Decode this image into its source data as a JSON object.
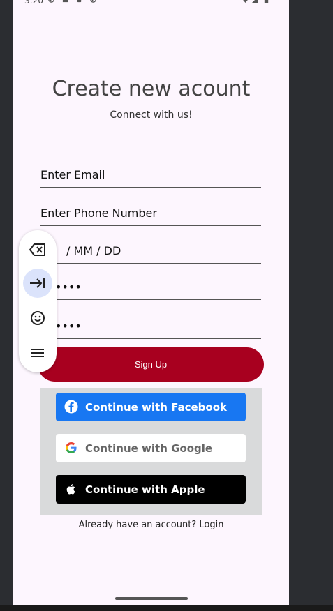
{
  "status_bar": {
    "time": "3:20"
  },
  "header": {
    "title": "Create new acount",
    "subtitle": "Connect with us!"
  },
  "form": {
    "fields": [
      {
        "placeholder": ""
      },
      {
        "placeholder": "Enter Email"
      },
      {
        "placeholder": "Enter Phone Number"
      },
      {
        "placeholder": "/ MM / DD"
      },
      {
        "placeholder": "••••"
      },
      {
        "placeholder": "••••"
      }
    ],
    "signup_label": "Sign Up"
  },
  "social": {
    "facebook_label": "Continue with Facebook",
    "google_label": "Continue with Google",
    "apple_label": "Continue with Apple",
    "colors": {
      "facebook": "#1877f2",
      "google": "#ffffff",
      "apple": "#000000"
    }
  },
  "footer": {
    "login_text": "Already have an account? Login"
  },
  "keyboard_toolbar": {
    "items": [
      "backspace-icon",
      "tab-icon",
      "emoji-icon",
      "menu-icon"
    ]
  },
  "colors": {
    "accent": "#a8001f",
    "background": "#fdf6fe"
  }
}
